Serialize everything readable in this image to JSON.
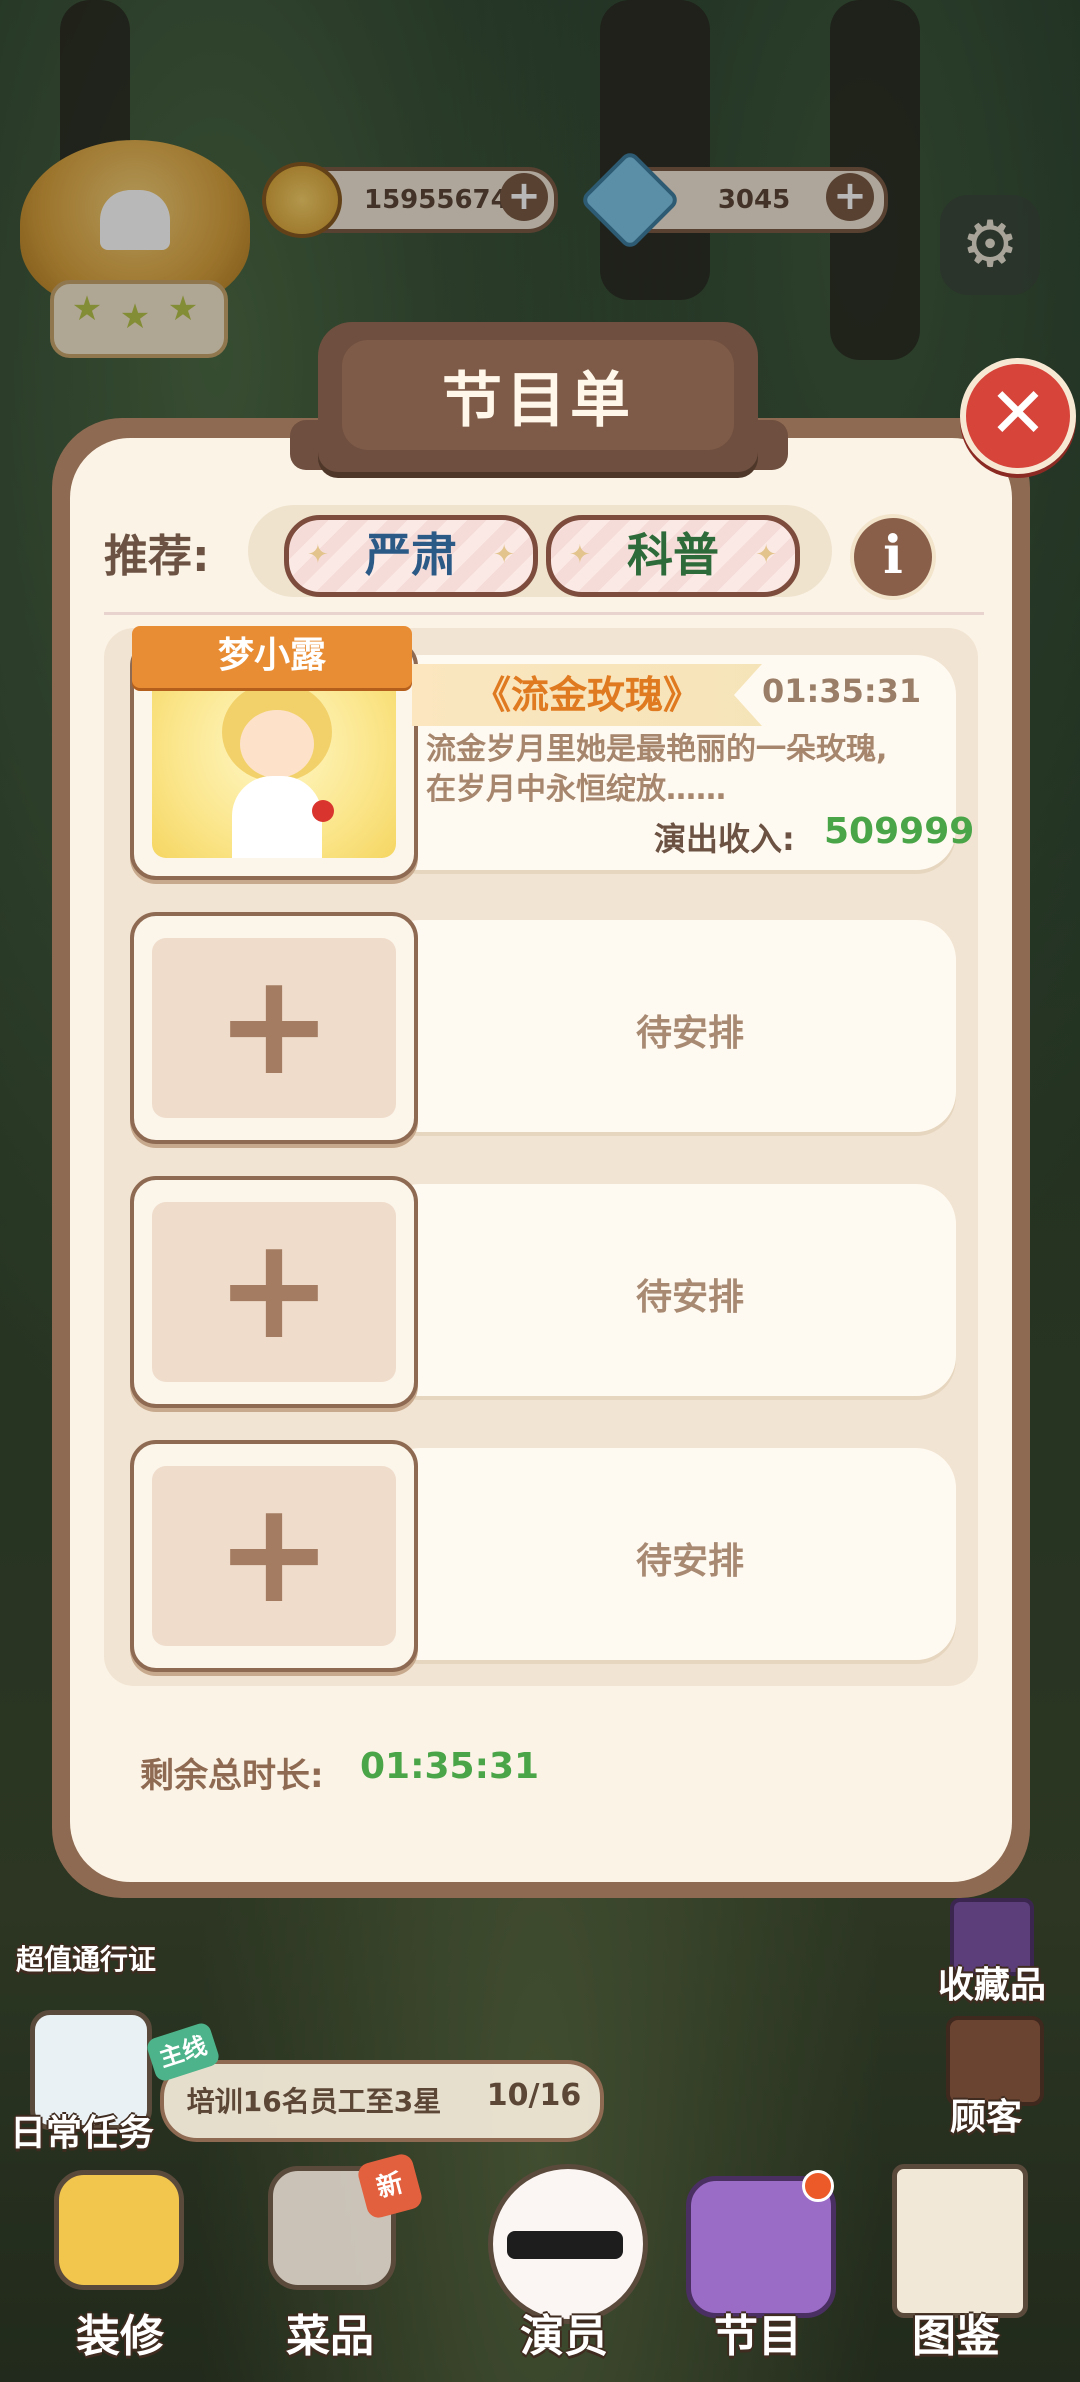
{
  "hud": {
    "coins": "15955674",
    "gems": "3045"
  },
  "dialog": {
    "title": "节目单",
    "recommend_label": "推荐:",
    "tags": [
      "严肃",
      "科普"
    ],
    "tag_colors": [
      "#2c5a86",
      "#2e6b3a"
    ],
    "program": {
      "performer": "梦小露",
      "title": "《流金玫瑰》",
      "time": "01:35:31",
      "description_line1": "流金岁月里她是最艳丽的一朵玫瑰,",
      "description_line2": "在岁月中永恒绽放……",
      "income_label": "演出收入:",
      "income_value": "509999"
    },
    "empty_slots": [
      {
        "label": "待安排"
      },
      {
        "label": "待安排"
      },
      {
        "label": "待安排"
      }
    ],
    "remaining_label": "剩余总时长:",
    "remaining_value": "01:35:31"
  },
  "side_left": {
    "pass_label": "超值通行证",
    "daily_label": "日常任务"
  },
  "side_right": {
    "collection_label": "收藏品",
    "customers_label": "顾客"
  },
  "quest": {
    "tag": "主线",
    "text": "培训16名员工至3星",
    "progress": "10/16"
  },
  "nav": {
    "decorate": "装修",
    "dishes": "菜品",
    "dishes_badge": "新",
    "actors": "演员",
    "programs": "节目",
    "gallery": "图鉴"
  },
  "colors": {
    "accent_green": "#4aa548",
    "title_orange": "#e07a21",
    "panel_brown": "#8f6a52",
    "close_red": "#d6443a"
  }
}
